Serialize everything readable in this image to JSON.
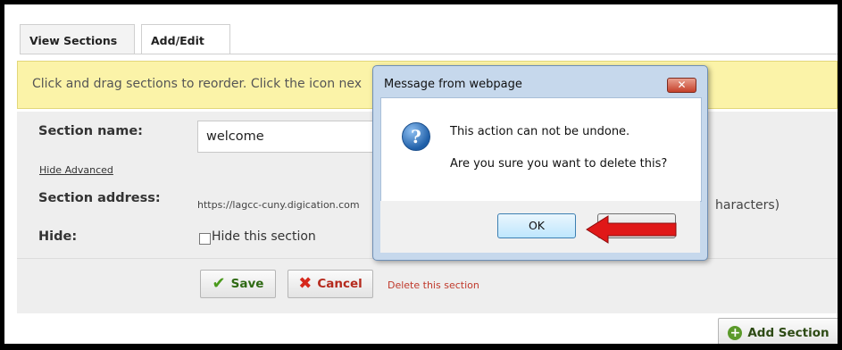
{
  "tabs": [
    {
      "label": "View Sections"
    },
    {
      "label": "Add/Edit"
    }
  ],
  "info_banner": "Click and drag sections to reorder. Click the icon nex",
  "form": {
    "section_name_label": "Section name:",
    "section_name_value": "welcome",
    "hide_advanced_link": "Hide Advanced",
    "section_address_label": "Section address:",
    "section_address_prefix": "https://lagcc-cuny.digication.com",
    "section_address_tail": "haracters)",
    "hide_label": "Hide:",
    "hide_checkbox_label": "Hide this section",
    "hide_checked": false
  },
  "actions": {
    "save": "Save",
    "cancel": "Cancel",
    "delete": "Delete this section",
    "add_section": "Add Section"
  },
  "dialog": {
    "title": "Message from webpage",
    "close_glyph": "✕",
    "icon_glyph": "?",
    "message_line1": "This action can not be undone.",
    "message_line2": "Are you sure you want to delete this?",
    "ok_label": "OK"
  },
  "colors": {
    "annotation_arrow": "#e01818",
    "banner_bg": "#fbf3a8"
  }
}
